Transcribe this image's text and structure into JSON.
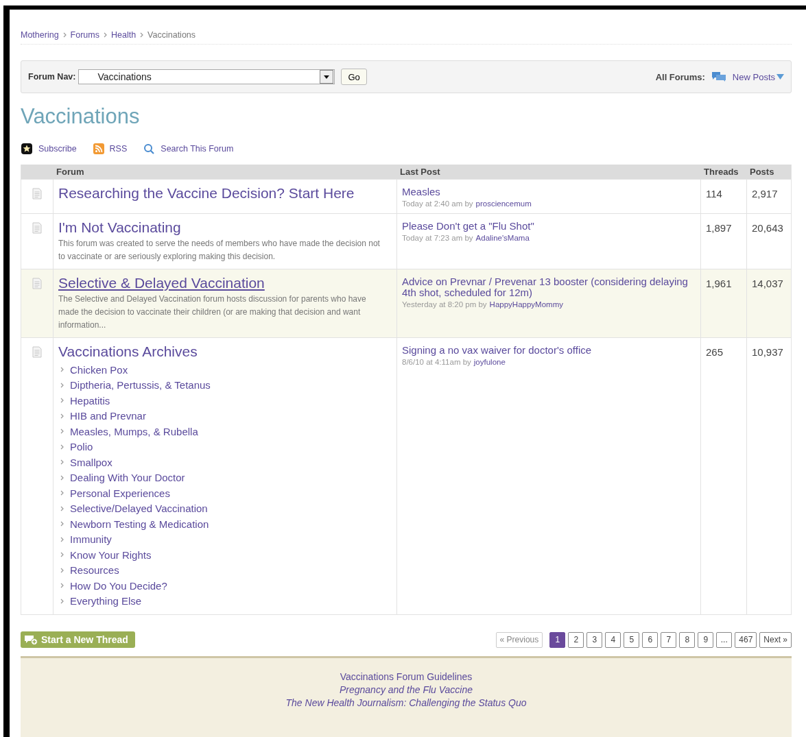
{
  "breadcrumb": [
    {
      "label": "Mothering",
      "current": false
    },
    {
      "label": "Forums",
      "current": false
    },
    {
      "label": "Health",
      "current": false
    },
    {
      "label": "Vaccinations",
      "current": true
    }
  ],
  "forum_nav": {
    "label": "Forum Nav:",
    "value": "Vaccinations",
    "go": "Go",
    "all_forums": "All Forums:",
    "new_posts": "New Posts"
  },
  "title": "Vaccinations",
  "actions": [
    {
      "kind": "subscribe",
      "label": "Subscribe"
    },
    {
      "kind": "rss",
      "label": "RSS"
    },
    {
      "kind": "search",
      "label": "Search This Forum"
    }
  ],
  "table": {
    "columns": [
      "Forum",
      "Last Post",
      "Threads",
      "Posts"
    ],
    "rows": [
      {
        "title": "Researching the Vaccine Decision? Start Here",
        "highlighted": false,
        "last_post": "Measles",
        "when": "Today at 2:40 am by",
        "user": "prosciencemum",
        "threads": "114",
        "posts": "2,917"
      },
      {
        "title": "I'm Not Vaccinating",
        "description": "This forum was created to serve the needs of members who have made the decision not to vaccinate or are seriously exploring making this decision.",
        "highlighted": false,
        "last_post": "Please Don't get a \"Flu Shot\"",
        "when": "Today at 7:23 am by",
        "user": "Adaline'sMama",
        "threads": "1,897",
        "posts": "20,643"
      },
      {
        "title": "Selective & Delayed Vaccination",
        "description": "The Selective and Delayed Vaccination forum hosts discussion for parents who have made the decision to vaccinate their children (or are making that decision and want information...",
        "highlighted": true,
        "last_post": "Advice on Prevnar / Prevenar 13 booster (considering delaying 4th shot, scheduled for 12m)",
        "when": "Yesterday at 8:20 pm by",
        "user": "HappyHappyMommy",
        "threads": "1,961",
        "posts": "14,037"
      },
      {
        "title": "Vaccinations Archives",
        "highlighted": false,
        "subforums": [
          "Chicken Pox",
          "Diptheria, Pertussis, & Tetanus",
          "Hepatitis",
          "HIB and Prevnar",
          "Measles, Mumps, & Rubella",
          "Polio",
          "Smallpox",
          "Dealing With Your Doctor",
          "Personal Experiences",
          "Selective/Delayed Vaccination",
          "Newborn Testing & Medication",
          "Immunity",
          "Know Your Rights",
          "Resources",
          "How Do You Decide?",
          "Everything Else"
        ],
        "last_post": "Signing a no vax waiver for doctor's office",
        "when": "8/6/10 at 4:11am by",
        "user": "joyfulone",
        "threads": "265",
        "posts": "10,937"
      }
    ]
  },
  "new_thread": "Start a New Thread",
  "pagination": {
    "previous": "« Previous",
    "pages": [
      {
        "label": "1",
        "selected": true
      },
      {
        "label": "2",
        "selected": false
      },
      {
        "label": "3",
        "selected": false
      },
      {
        "label": "4",
        "selected": false
      },
      {
        "label": "5",
        "selected": false
      },
      {
        "label": "6",
        "selected": false
      },
      {
        "label": "7",
        "selected": false
      },
      {
        "label": "8",
        "selected": false
      },
      {
        "label": "9",
        "selected": false
      },
      {
        "label": "...",
        "selected": false
      },
      {
        "label": "467",
        "selected": false
      }
    ],
    "next": "Next »"
  },
  "footer_links": [
    {
      "label": "Vaccinations Forum Guidelines",
      "italic": false
    },
    {
      "label": "Pregnancy and the Flu Vaccine",
      "italic": true
    },
    {
      "label": "The New Health Journalism: Challenging the Status Quo",
      "italic": true
    }
  ]
}
